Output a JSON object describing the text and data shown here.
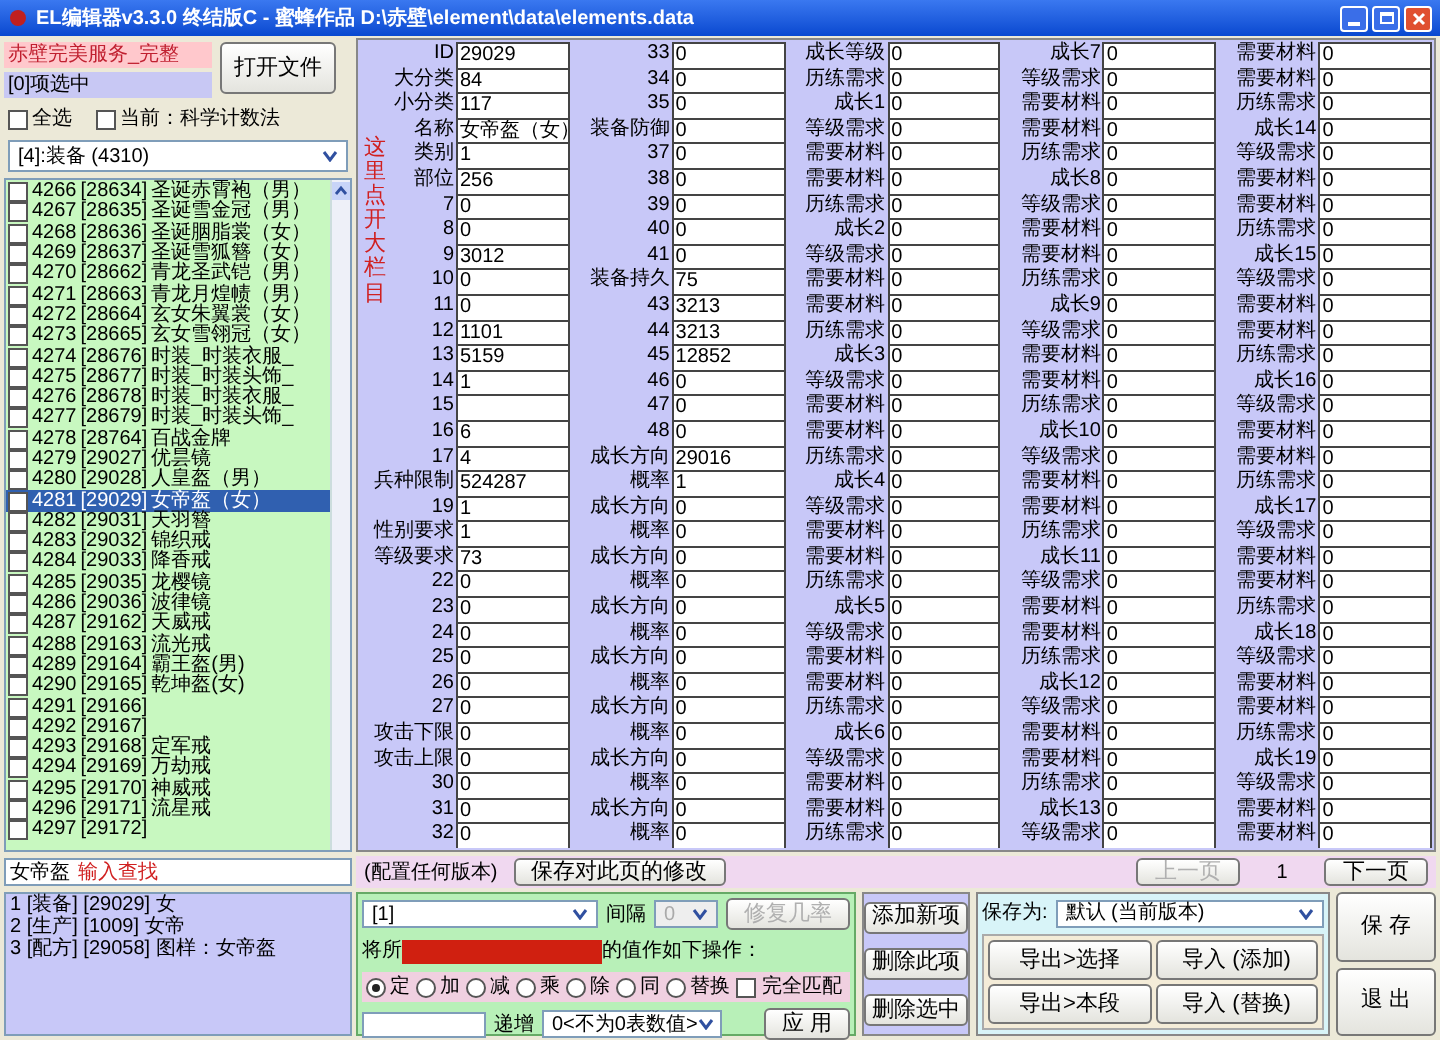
{
  "window": {
    "title": "EL编辑器v3.3.0 终结版C - 蜜蜂作品 D:\\赤壁\\element\\data\\elements.data"
  },
  "server_label": "赤壁完美服务_完整",
  "selection_count": "[0]项选中",
  "open_button": "打开文件",
  "options": [
    {
      "label": "全选",
      "checked": false
    },
    {
      "label": "当前：科学计数法",
      "checked": false
    }
  ],
  "category": {
    "value": "[4]:装备 (4310)"
  },
  "annotations": [
    {
      "kind": "vertical",
      "text": "这里点开大栏目"
    },
    {
      "kind": "inline",
      "text": "输入查找"
    }
  ],
  "items": [
    {
      "index": "4266",
      "id": "[28634]",
      "name": "圣诞赤霄袍（男）",
      "checked": false,
      "selected": false
    },
    {
      "index": "4267",
      "id": "[28635]",
      "name": "圣诞雪金冠（男）",
      "checked": false,
      "selected": false
    },
    {
      "index": "4268",
      "id": "[28636]",
      "name": "圣诞胭脂裳（女）",
      "checked": false,
      "selected": false
    },
    {
      "index": "4269",
      "id": "[28637]",
      "name": "圣诞雪狐簪（女）",
      "checked": false,
      "selected": false
    },
    {
      "index": "4270",
      "id": "[28662]",
      "name": "青龙圣武铠（男）",
      "checked": false,
      "selected": false
    },
    {
      "index": "4271",
      "id": "[28663]",
      "name": "青龙月煌帻（男）",
      "checked": false,
      "selected": false
    },
    {
      "index": "4272",
      "id": "[28664]",
      "name": "玄女朱翼裳（女）",
      "checked": false,
      "selected": false
    },
    {
      "index": "4273",
      "id": "[28665]",
      "name": "玄女雪翎冠（女）",
      "checked": false,
      "selected": false
    },
    {
      "index": "4274",
      "id": "[28676]",
      "name": "时装_时装衣服_",
      "checked": false,
      "selected": false
    },
    {
      "index": "4275",
      "id": "[28677]",
      "name": "时装_时装头饰_",
      "checked": false,
      "selected": false
    },
    {
      "index": "4276",
      "id": "[28678]",
      "name": "时装_时装衣服_",
      "checked": false,
      "selected": false
    },
    {
      "index": "4277",
      "id": "[28679]",
      "name": "时装_时装头饰_",
      "checked": false,
      "selected": false
    },
    {
      "index": "4278",
      "id": "[28764]",
      "name": "百战金牌",
      "checked": false,
      "selected": false
    },
    {
      "index": "4279",
      "id": "[29027]",
      "name": "优昙镜",
      "checked": false,
      "selected": false
    },
    {
      "index": "4280",
      "id": "[29028]",
      "name": "人皇盔（男）",
      "checked": false,
      "selected": false
    },
    {
      "index": "4281",
      "id": "[29029]",
      "name": "女帝盔（女）",
      "checked": false,
      "selected": true
    },
    {
      "index": "4282",
      "id": "[29031]",
      "name": "天羽簪",
      "checked": false,
      "selected": false
    },
    {
      "index": "4283",
      "id": "[29032]",
      "name": "锦织戒",
      "checked": false,
      "selected": false
    },
    {
      "index": "4284",
      "id": "[29033]",
      "name": "降香戒",
      "checked": false,
      "selected": false
    },
    {
      "index": "4285",
      "id": "[29035]",
      "name": "龙樱镜",
      "checked": false,
      "selected": false
    },
    {
      "index": "4286",
      "id": "[29036]",
      "name": "波律镜",
      "checked": false,
      "selected": false
    },
    {
      "index": "4287",
      "id": "[29162]",
      "name": "天威戒",
      "checked": false,
      "selected": false
    },
    {
      "index": "4288",
      "id": "[29163]",
      "name": "流光戒",
      "checked": false,
      "selected": false
    },
    {
      "index": "4289",
      "id": "[29164]",
      "name": "霸王盔(男)",
      "checked": false,
      "selected": false
    },
    {
      "index": "4290",
      "id": "[29165]",
      "name": "乾坤盔(女)",
      "checked": false,
      "selected": false
    },
    {
      "index": "4291",
      "id": "[29166]",
      "checked": false,
      "selected": false
    },
    {
      "index": "4292",
      "id": "[29167]",
      "checked": false,
      "selected": false
    },
    {
      "index": "4293",
      "id": "[29168]",
      "name": "定军戒",
      "checked": false,
      "selected": false
    },
    {
      "index": "4294",
      "id": "[29169]",
      "name": "万劫戒",
      "checked": false,
      "selected": false
    },
    {
      "index": "4295",
      "id": "[29170]",
      "name": "神威戒",
      "checked": false,
      "selected": false
    },
    {
      "index": "4296",
      "id": "[29171]",
      "name": "流星戒",
      "checked": false,
      "selected": false
    },
    {
      "index": "4297",
      "id": "[29172]",
      "checked": false,
      "selected": false
    }
  ],
  "search": {
    "value": "女帝盔"
  },
  "results": [
    "1 [装备] [29029] 女",
    "2 [生产] [1009] 女帝",
    "3 [配方] [29058] 图样：女帝盔"
  ],
  "fields": [
    [
      {
        "label": "ID",
        "value": "29029"
      },
      {
        "label": "大分类",
        "value": "84"
      },
      {
        "label": "小分类",
        "value": "117"
      },
      {
        "label": "名称",
        "value": "女帝盔（女）"
      },
      {
        "label": "类别",
        "value": "1"
      },
      {
        "label": "部位",
        "value": "256"
      },
      {
        "label": "7",
        "value": "0"
      },
      {
        "label": "8",
        "value": "0"
      },
      {
        "label": "9",
        "value": "3012"
      },
      {
        "label": "10",
        "value": "0"
      },
      {
        "label": "11",
        "value": "0"
      },
      {
        "label": "12",
        "value": "1101"
      },
      {
        "label": "13",
        "value": "5159"
      },
      {
        "label": "14",
        "value": "1"
      },
      {
        "label": "15"
      },
      {
        "label": "16",
        "value": "6"
      },
      {
        "label": "17",
        "value": "4"
      },
      {
        "label": "兵种限制",
        "value": "524287"
      },
      {
        "label": "19",
        "value": "1"
      },
      {
        "label": "性别要求",
        "value": "1"
      },
      {
        "label": "等级要求",
        "value": "73"
      },
      {
        "label": "22",
        "value": "0"
      },
      {
        "label": "23",
        "value": "0"
      },
      {
        "label": "24",
        "value": "0"
      },
      {
        "label": "25",
        "value": "0"
      },
      {
        "label": "26",
        "value": "0"
      },
      {
        "label": "27",
        "value": "0"
      },
      {
        "label": "攻击下限",
        "value": "0"
      },
      {
        "label": "攻击上限",
        "value": "0"
      },
      {
        "label": "30",
        "value": "0"
      },
      {
        "label": "31",
        "value": "0"
      },
      {
        "label": "32",
        "value": "0"
      }
    ],
    [
      {
        "label": "33",
        "value": "0"
      },
      {
        "label": "34",
        "value": "0"
      },
      {
        "label": "35",
        "value": "0"
      },
      {
        "label": "装备防御",
        "value": "0"
      },
      {
        "label": "37",
        "value": "0"
      },
      {
        "label": "38",
        "value": "0"
      },
      {
        "label": "39",
        "value": "0"
      },
      {
        "label": "40",
        "value": "0"
      },
      {
        "label": "41",
        "value": "0"
      },
      {
        "label": "装备持久",
        "value": "75"
      },
      {
        "label": "43",
        "value": "3213"
      },
      {
        "label": "44",
        "value": "3213"
      },
      {
        "label": "45",
        "value": "12852"
      },
      {
        "label": "46",
        "value": "0"
      },
      {
        "label": "47",
        "value": "0"
      },
      {
        "label": "48",
        "value": "0"
      },
      {
        "label": "成长方向",
        "value": "29016"
      },
      {
        "label": "概率",
        "value": "1"
      },
      {
        "label": "成长方向",
        "value": "0"
      },
      {
        "label": "概率",
        "value": "0"
      },
      {
        "label": "成长方向",
        "value": "0"
      },
      {
        "label": "概率",
        "value": "0"
      },
      {
        "label": "成长方向",
        "value": "0"
      },
      {
        "label": "概率",
        "value": "0"
      },
      {
        "label": "成长方向",
        "value": "0"
      },
      {
        "label": "概率",
        "value": "0"
      },
      {
        "label": "成长方向",
        "value": "0"
      },
      {
        "label": "概率",
        "value": "0"
      },
      {
        "label": "成长方向",
        "value": "0"
      },
      {
        "label": "概率",
        "value": "0"
      },
      {
        "label": "成长方向",
        "value": "0"
      },
      {
        "label": "概率",
        "value": "0"
      }
    ],
    [
      {
        "label": "成长等级",
        "value": "0"
      },
      {
        "label": "历练需求",
        "value": "0"
      },
      {
        "label": "成长1",
        "value": "0"
      },
      {
        "label": "等级需求",
        "value": "0"
      },
      {
        "label": "需要材料",
        "value": "0"
      },
      {
        "label": "需要材料",
        "value": "0"
      },
      {
        "label": "历练需求",
        "value": "0"
      },
      {
        "label": "成长2",
        "value": "0"
      },
      {
        "label": "等级需求",
        "value": "0"
      },
      {
        "label": "需要材料",
        "value": "0"
      },
      {
        "label": "需要材料",
        "value": "0"
      },
      {
        "label": "历练需求",
        "value": "0"
      },
      {
        "label": "成长3",
        "value": "0"
      },
      {
        "label": "等级需求",
        "value": "0"
      },
      {
        "label": "需要材料",
        "value": "0"
      },
      {
        "label": "需要材料",
        "value": "0"
      },
      {
        "label": "历练需求",
        "value": "0"
      },
      {
        "label": "成长4",
        "value": "0"
      },
      {
        "label": "等级需求",
        "value": "0"
      },
      {
        "label": "需要材料",
        "value": "0"
      },
      {
        "label": "需要材料",
        "value": "0"
      },
      {
        "label": "历练需求",
        "value": "0"
      },
      {
        "label": "成长5",
        "value": "0"
      },
      {
        "label": "等级需求",
        "value": "0"
      },
      {
        "label": "需要材料",
        "value": "0"
      },
      {
        "label": "需要材料",
        "value": "0"
      },
      {
        "label": "历练需求",
        "value": "0"
      },
      {
        "label": "成长6",
        "value": "0"
      },
      {
        "label": "等级需求",
        "value": "0"
      },
      {
        "label": "需要材料",
        "value": "0"
      },
      {
        "label": "需要材料",
        "value": "0"
      },
      {
        "label": "历练需求",
        "value": "0"
      }
    ],
    [
      {
        "label": "成长7",
        "value": "0"
      },
      {
        "label": "等级需求",
        "value": "0"
      },
      {
        "label": "需要材料",
        "value": "0"
      },
      {
        "label": "需要材料",
        "value": "0"
      },
      {
        "label": "历练需求",
        "value": "0"
      },
      {
        "label": "成长8",
        "value": "0"
      },
      {
        "label": "等级需求",
        "value": "0"
      },
      {
        "label": "需要材料",
        "value": "0"
      },
      {
        "label": "需要材料",
        "value": "0"
      },
      {
        "label": "历练需求",
        "value": "0"
      },
      {
        "label": "成长9",
        "value": "0"
      },
      {
        "label": "等级需求",
        "value": "0"
      },
      {
        "label": "需要材料",
        "value": "0"
      },
      {
        "label": "需要材料",
        "value": "0"
      },
      {
        "label": "历练需求",
        "value": "0"
      },
      {
        "label": "成长10",
        "value": "0"
      },
      {
        "label": "等级需求",
        "value": "0"
      },
      {
        "label": "需要材料",
        "value": "0"
      },
      {
        "label": "需要材料",
        "value": "0"
      },
      {
        "label": "历练需求",
        "value": "0"
      },
      {
        "label": "成长11",
        "value": "0"
      },
      {
        "label": "等级需求",
        "value": "0"
      },
      {
        "label": "需要材料",
        "value": "0"
      },
      {
        "label": "需要材料",
        "value": "0"
      },
      {
        "label": "历练需求",
        "value": "0"
      },
      {
        "label": "成长12",
        "value": "0"
      },
      {
        "label": "等级需求",
        "value": "0"
      },
      {
        "label": "需要材料",
        "value": "0"
      },
      {
        "label": "需要材料",
        "value": "0"
      },
      {
        "label": "历练需求",
        "value": "0"
      },
      {
        "label": "成长13",
        "value": "0"
      },
      {
        "label": "等级需求",
        "value": "0"
      }
    ],
    [
      {
        "label": "需要材料",
        "value": "0"
      },
      {
        "label": "需要材料",
        "value": "0"
      },
      {
        "label": "历练需求",
        "value": "0"
      },
      {
        "label": "成长14",
        "value": "0"
      },
      {
        "label": "等级需求",
        "value": "0"
      },
      {
        "label": "需要材料",
        "value": "0"
      },
      {
        "label": "需要材料",
        "value": "0"
      },
      {
        "label": "历练需求",
        "value": "0"
      },
      {
        "label": "成长15",
        "value": "0"
      },
      {
        "label": "等级需求",
        "value": "0"
      },
      {
        "label": "需要材料",
        "value": "0"
      },
      {
        "label": "需要材料",
        "value": "0"
      },
      {
        "label": "历练需求",
        "value": "0"
      },
      {
        "label": "成长16",
        "value": "0"
      },
      {
        "label": "等级需求",
        "value": "0"
      },
      {
        "label": "需要材料",
        "value": "0"
      },
      {
        "label": "需要材料",
        "value": "0"
      },
      {
        "label": "历练需求",
        "value": "0"
      },
      {
        "label": "成长17",
        "value": "0"
      },
      {
        "label": "等级需求",
        "value": "0"
      },
      {
        "label": "需要材料",
        "value": "0"
      },
      {
        "label": "需要材料",
        "value": "0"
      },
      {
        "label": "历练需求",
        "value": "0"
      },
      {
        "label": "成长18",
        "value": "0"
      },
      {
        "label": "等级需求",
        "value": "0"
      },
      {
        "label": "需要材料",
        "value": "0"
      },
      {
        "label": "需要材料",
        "value": "0"
      },
      {
        "label": "历练需求",
        "value": "0"
      },
      {
        "label": "成长19",
        "value": "0"
      },
      {
        "label": "等级需求",
        "value": "0"
      },
      {
        "label": "需要材料",
        "value": "0"
      },
      {
        "label": "需要材料",
        "value": "0"
      }
    ]
  ],
  "status_text": "(配置任何版本)",
  "page_buttons": [
    {
      "label": "保存对此页的修改",
      "disabled": false
    },
    {
      "label": "上一页",
      "disabled": true
    },
    {
      "label": "下一页",
      "disabled": false
    }
  ],
  "page_number": "1",
  "batch": {
    "field_select": "[1]",
    "interval_label": "间隔",
    "interval_value": "0",
    "repair_button": {
      "label": "修复几率",
      "disabled": true
    },
    "prefix": "将所",
    "operation_text": "的值作如下操作：",
    "operations": [
      {
        "label": "定",
        "selected": true
      },
      {
        "label": "加",
        "selected": false
      },
      {
        "label": "减",
        "selected": false
      },
      {
        "label": "乘",
        "selected": false
      },
      {
        "label": "除",
        "selected": false
      },
      {
        "label": "同",
        "selected": false
      },
      {
        "label": "替换",
        "selected": false
      }
    ],
    "exact_match": {
      "label": "完全匹配",
      "checked": false
    },
    "increment_label": "递增",
    "increment_value": "0<不为0表数值>",
    "apply_button": "应 用"
  },
  "item_buttons": [
    "添加新项",
    "删除此项",
    "删除选中"
  ],
  "save_as": {
    "label": "保存为:",
    "value": "默认 (当前版本)"
  },
  "io_buttons": [
    "导出>选择",
    "导入 (添加)",
    "导出>本段",
    "导入 (替换)"
  ],
  "main_buttons": [
    "保 存",
    "退 出"
  ]
}
